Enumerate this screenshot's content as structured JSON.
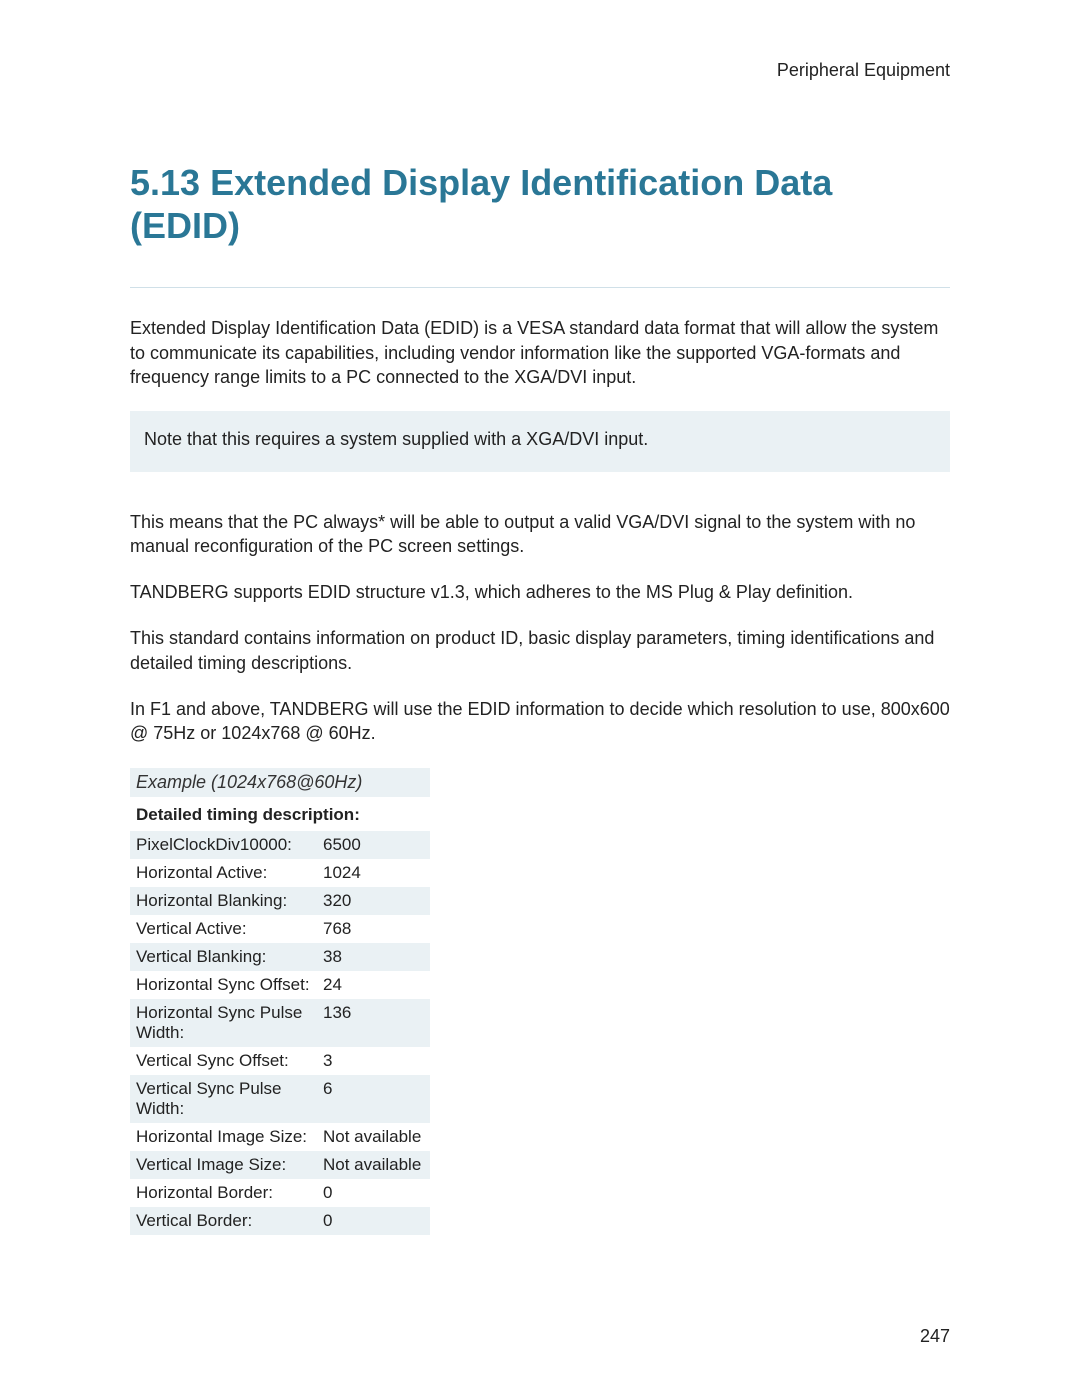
{
  "header": "Peripheral Equipment",
  "title_number": "5.13",
  "title_text": "Extended Display Identification Data (EDID)",
  "para1": "Extended Display Identification Data (EDID) is a VESA standard data format that will allow the system to communicate its capabilities, including vendor information like the supported VGA-formats and frequency range limits to a PC connected to the XGA/DVI input.",
  "note": "Note that this requires a system supplied with a XGA/DVI input.",
  "para2": "This means that the PC always* will be able to output a valid VGA/DVI signal to the system with no manual reconfiguration of the PC screen settings.",
  "para3": "TANDBERG supports EDID structure v1.3, which adheres to the MS Plug & Play definition.",
  "para4": "This standard contains information on product ID, basic display parameters, timing identifications and detailed timing descriptions.",
  "para5": "In F1 and above, TANDBERG will use the EDID information to decide which resolution to use, 800x600 @ 75Hz or 1024x768 @ 60Hz.",
  "example_title": "Example (1024x768@60Hz)",
  "table_header": "Detailed timing description:",
  "rows": [
    {
      "label": "PixelClockDiv10000:",
      "value": "6500"
    },
    {
      "label": "Horizontal Active:",
      "value": "1024"
    },
    {
      "label": "Horizontal Blanking:",
      "value": "320"
    },
    {
      "label": "Vertical Active:",
      "value": "768"
    },
    {
      "label": "Vertical Blanking:",
      "value": "38"
    },
    {
      "label": "Horizontal Sync Offset:",
      "value": "24"
    },
    {
      "label": "Horizontal Sync Pulse Width:",
      "value": "136"
    },
    {
      "label": "Vertical Sync Offset:",
      "value": "3"
    },
    {
      "label": "Vertical Sync Pulse Width:",
      "value": "6"
    },
    {
      "label": "Horizontal Image Size:",
      "value": "Not available"
    },
    {
      "label": "Vertical Image Size:",
      "value": "Not available"
    },
    {
      "label": "Horizontal Border:",
      "value": "0"
    },
    {
      "label": "Vertical Border:",
      "value": "0"
    }
  ],
  "page_number": "247"
}
